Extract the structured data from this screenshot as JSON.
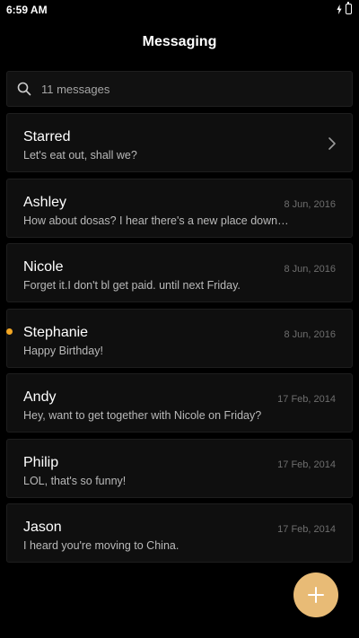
{
  "status_bar": {
    "time": "6:59 AM",
    "icons": [
      "charging-bolt-icon",
      "battery-icon"
    ]
  },
  "header": {
    "title": "Messaging"
  },
  "search": {
    "placeholder": "11 messages",
    "icon": "search-icon"
  },
  "conversations": [
    {
      "name": "Starred",
      "preview": "Let's eat out, shall we?",
      "date": "",
      "has_chevron": true,
      "unread": false
    },
    {
      "name": "Ashley",
      "preview": "How about dosas? I hear there's a new place downtown",
      "date": "8 Jun, 2016",
      "has_chevron": false,
      "unread": false
    },
    {
      "name": "Nicole",
      "preview": "Forget it.I don't bl get paid. until next Friday.",
      "date": "8 Jun, 2016",
      "has_chevron": false,
      "unread": false
    },
    {
      "name": "Stephanie",
      "preview": "Happy Birthday!",
      "date": "8 Jun, 2016",
      "has_chevron": false,
      "unread": true
    },
    {
      "name": "Andy",
      "preview": "Hey, want to get together with Nicole on Friday?",
      "date": "17 Feb, 2014",
      "has_chevron": false,
      "unread": false
    },
    {
      "name": "Philip",
      "preview": "LOL, that's so funny!",
      "date": "17 Feb, 2014",
      "has_chevron": false,
      "unread": false
    },
    {
      "name": "Jason",
      "preview": "I heard you're moving to China.",
      "date": "17 Feb, 2014",
      "has_chevron": false,
      "unread": false
    }
  ],
  "fab": {
    "icon": "plus-icon"
  },
  "colors": {
    "background": "#000000",
    "card": "#0f0f0f",
    "accent_fab": "#e8bb76",
    "unread_dot": "#f2a623",
    "text_primary": "#ffffff",
    "text_secondary": "#b9b9b9",
    "text_date": "#6e6e6e"
  }
}
